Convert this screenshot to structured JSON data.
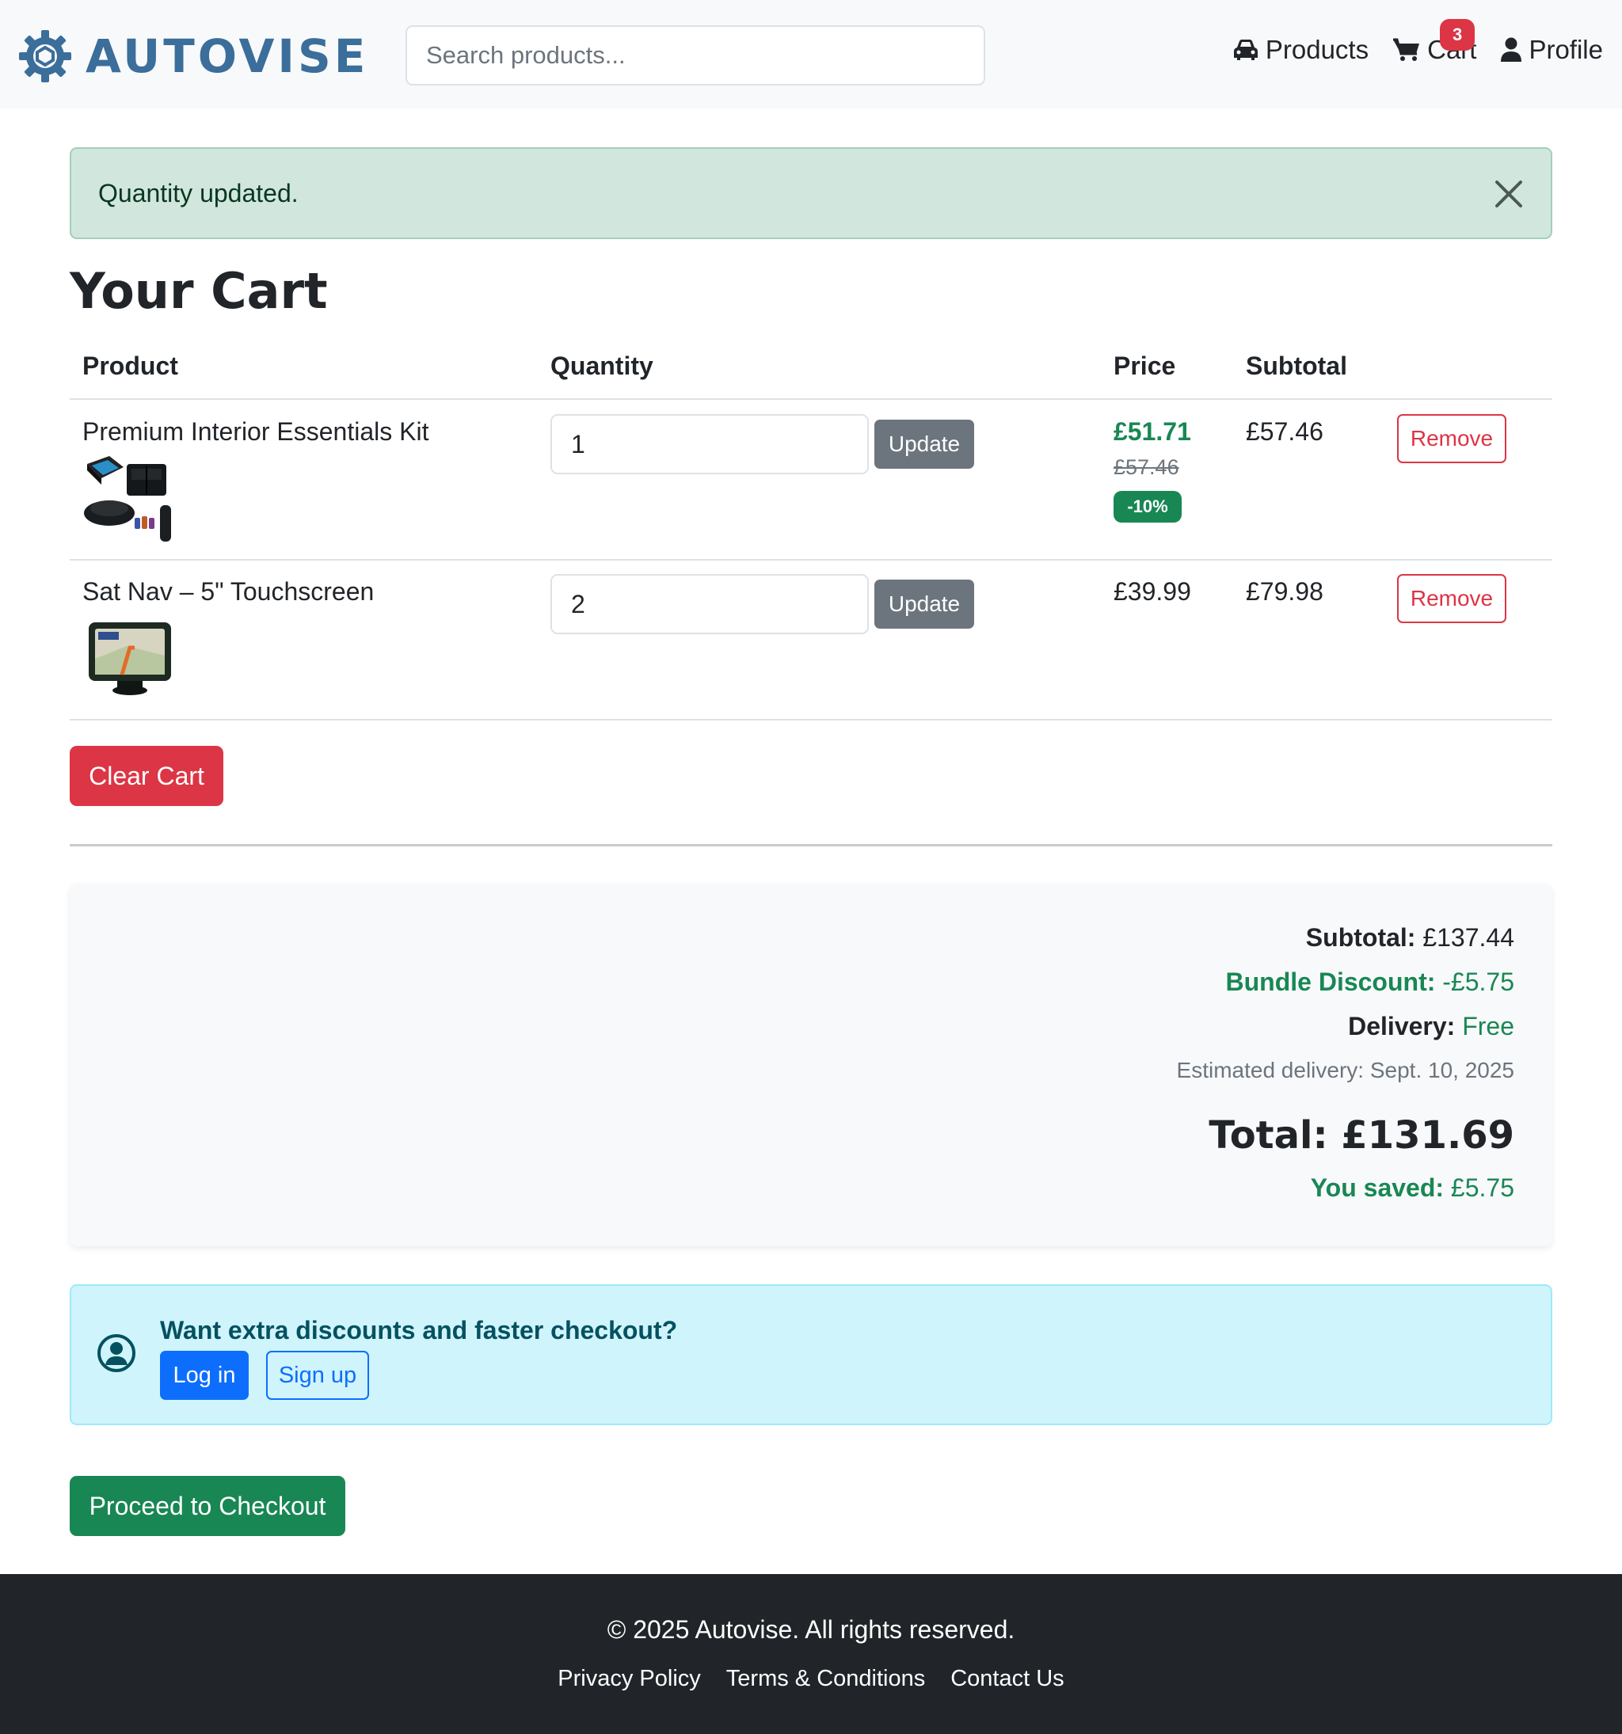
{
  "brand": {
    "name": "AUTOVISE"
  },
  "search": {
    "placeholder": "Search products..."
  },
  "nav": {
    "products": "Products",
    "cart": "Cart",
    "cart_count": "3",
    "profile": "Profile"
  },
  "alert": {
    "message": "Quantity updated."
  },
  "page_title": "Your Cart",
  "table": {
    "headers": [
      "Product",
      "Quantity",
      "Price",
      "Subtotal"
    ],
    "items": [
      {
        "name": "Premium Interior Essentials Kit",
        "quantity": "1",
        "price": "£51.71",
        "original_price": "£57.46",
        "discount_badge": "-10%",
        "subtotal": "£57.46",
        "update_label": "Update",
        "remove_label": "Remove"
      },
      {
        "name": "Sat Nav – 5\" Touchscreen",
        "quantity": "2",
        "price": "£39.99",
        "subtotal": "£79.98",
        "update_label": "Update",
        "remove_label": "Remove"
      }
    ]
  },
  "clear_cart_label": "Clear Cart",
  "summary": {
    "subtotal_label": "Subtotal:",
    "subtotal_value": "£137.44",
    "bundle_label": "Bundle Discount:",
    "bundle_value": "-£5.75",
    "delivery_label": "Delivery:",
    "delivery_value": "Free",
    "estimated_delivery": "Estimated delivery: Sept. 10, 2025",
    "total_label": "Total:",
    "total_value": "£131.69",
    "saved_label": "You saved:",
    "saved_value": "£5.75"
  },
  "login_prompt": {
    "title": "Want extra discounts and faster checkout?",
    "login_label": "Log in",
    "signup_label": "Sign up"
  },
  "checkout_label": "Proceed to Checkout",
  "footer": {
    "copyright": "© 2025 Autovise. All rights reserved.",
    "links": [
      "Privacy Policy",
      "Terms & Conditions",
      "Contact Us"
    ]
  },
  "colors": {
    "brand": "#3b6e9a",
    "success": "#198754",
    "danger": "#dc3545",
    "primary": "#0d6efd",
    "secondary": "#6c757d",
    "footer_bg": "#212529"
  },
  "icons": [
    "gear-logo-icon",
    "car-icon",
    "cart-icon",
    "user-icon",
    "close-icon",
    "user-circle-icon"
  ]
}
